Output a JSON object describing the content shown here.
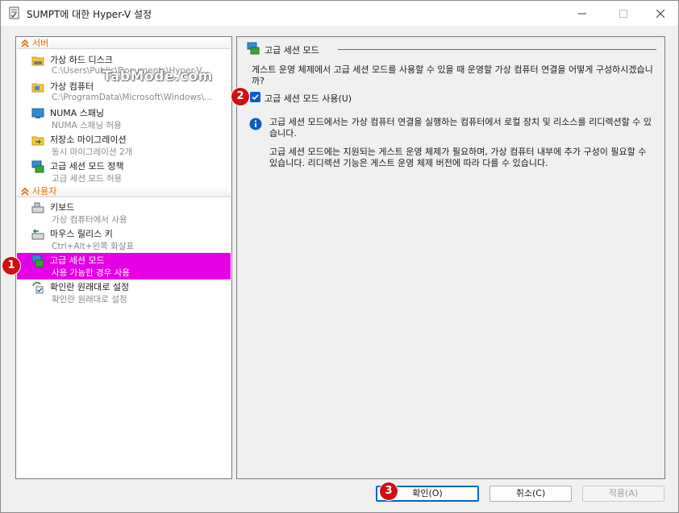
{
  "window": {
    "title": "SUMPT에 대한 Hyper-V 설정"
  },
  "tree": {
    "categories": [
      {
        "label": "서버"
      },
      {
        "label": "사용자"
      }
    ],
    "server_items": [
      {
        "name": "가상 하드 디스크",
        "sub": "C:\\Users\\Public\\Documents\\Hyper-V..."
      },
      {
        "name": "가상 컴퓨터",
        "sub": "C:\\ProgramData\\Microsoft\\Windows\\..."
      },
      {
        "name": "NUMA 스패닝",
        "sub": "NUMA 스패닝 허용"
      },
      {
        "name": "저장소 마이그레이션",
        "sub": "동시 마이그레이션 2개"
      },
      {
        "name": "고급 세션 모드 정책",
        "sub": "고급 세션 모드 허용"
      }
    ],
    "user_items": [
      {
        "name": "키보드",
        "sub": "가상 컴퓨터에서 사용"
      },
      {
        "name": "마우스 릴리스 키",
        "sub": "Ctrl+Alt+왼쪽 화살표"
      },
      {
        "name": "고급 세션 모드",
        "sub": "사용 가능한 경우 사용"
      },
      {
        "name": "확인란 원래대로 설정",
        "sub": "확인란 원래대로 설정"
      }
    ]
  },
  "watermark": "TabMode.com",
  "panel": {
    "heading": "고급 세션 모드",
    "description": "게스트 운영 체제에서 고급 세션 모드를 사용할 수 있을 때 운영할 가상 컴퓨터 연결을 어떻게 구성하시겠습니까?",
    "checkbox_label": "고급 세션 모드 사용(U)",
    "checkbox_checked": true,
    "info1": "고급 세션 모드에서는 가상 컴퓨터 연결을 실행하는 컴퓨터에서 로컬 장치 및 리소스를 리디렉션할 수 있습니다.",
    "info2": "고급 세션 모드에는 지원되는 게스트 운영 체제가 필요하며, 가상 컴퓨터 내부에 추가 구성이 필요할 수 있습니다. 리디렉션 기능은 게스트 운영 체제 버전에 따라 다를 수 있습니다."
  },
  "buttons": {
    "ok": "확인(O)",
    "cancel": "취소(C)",
    "apply": "적용(A)"
  },
  "badges": [
    "1",
    "2",
    "3"
  ],
  "colors": {
    "selection": "#e600e6",
    "category": "#e07000",
    "checkbox": "#0a5ec4",
    "badge": "#d01010"
  }
}
